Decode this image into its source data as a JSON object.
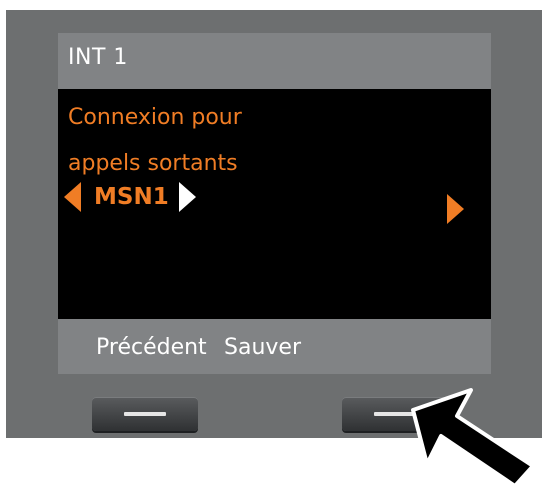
{
  "header": {
    "title": "INT 1"
  },
  "menu": {
    "line1": "Connexion pour",
    "line2": "appels sortants",
    "selected_value": "MSN1"
  },
  "softkeys": {
    "left_label": "Précédent",
    "right_label": "Sauver"
  },
  "icons": {
    "value_prev": "triangle-left-icon",
    "value_next": "triangle-right-icon",
    "next_option": "triangle-right-icon",
    "pointer": "arrow-pointer-icon"
  },
  "colors": {
    "accent": "#f07d25",
    "header_bg": "#818385",
    "screen_bg": "#000000",
    "bezel": "#6d6f70"
  }
}
